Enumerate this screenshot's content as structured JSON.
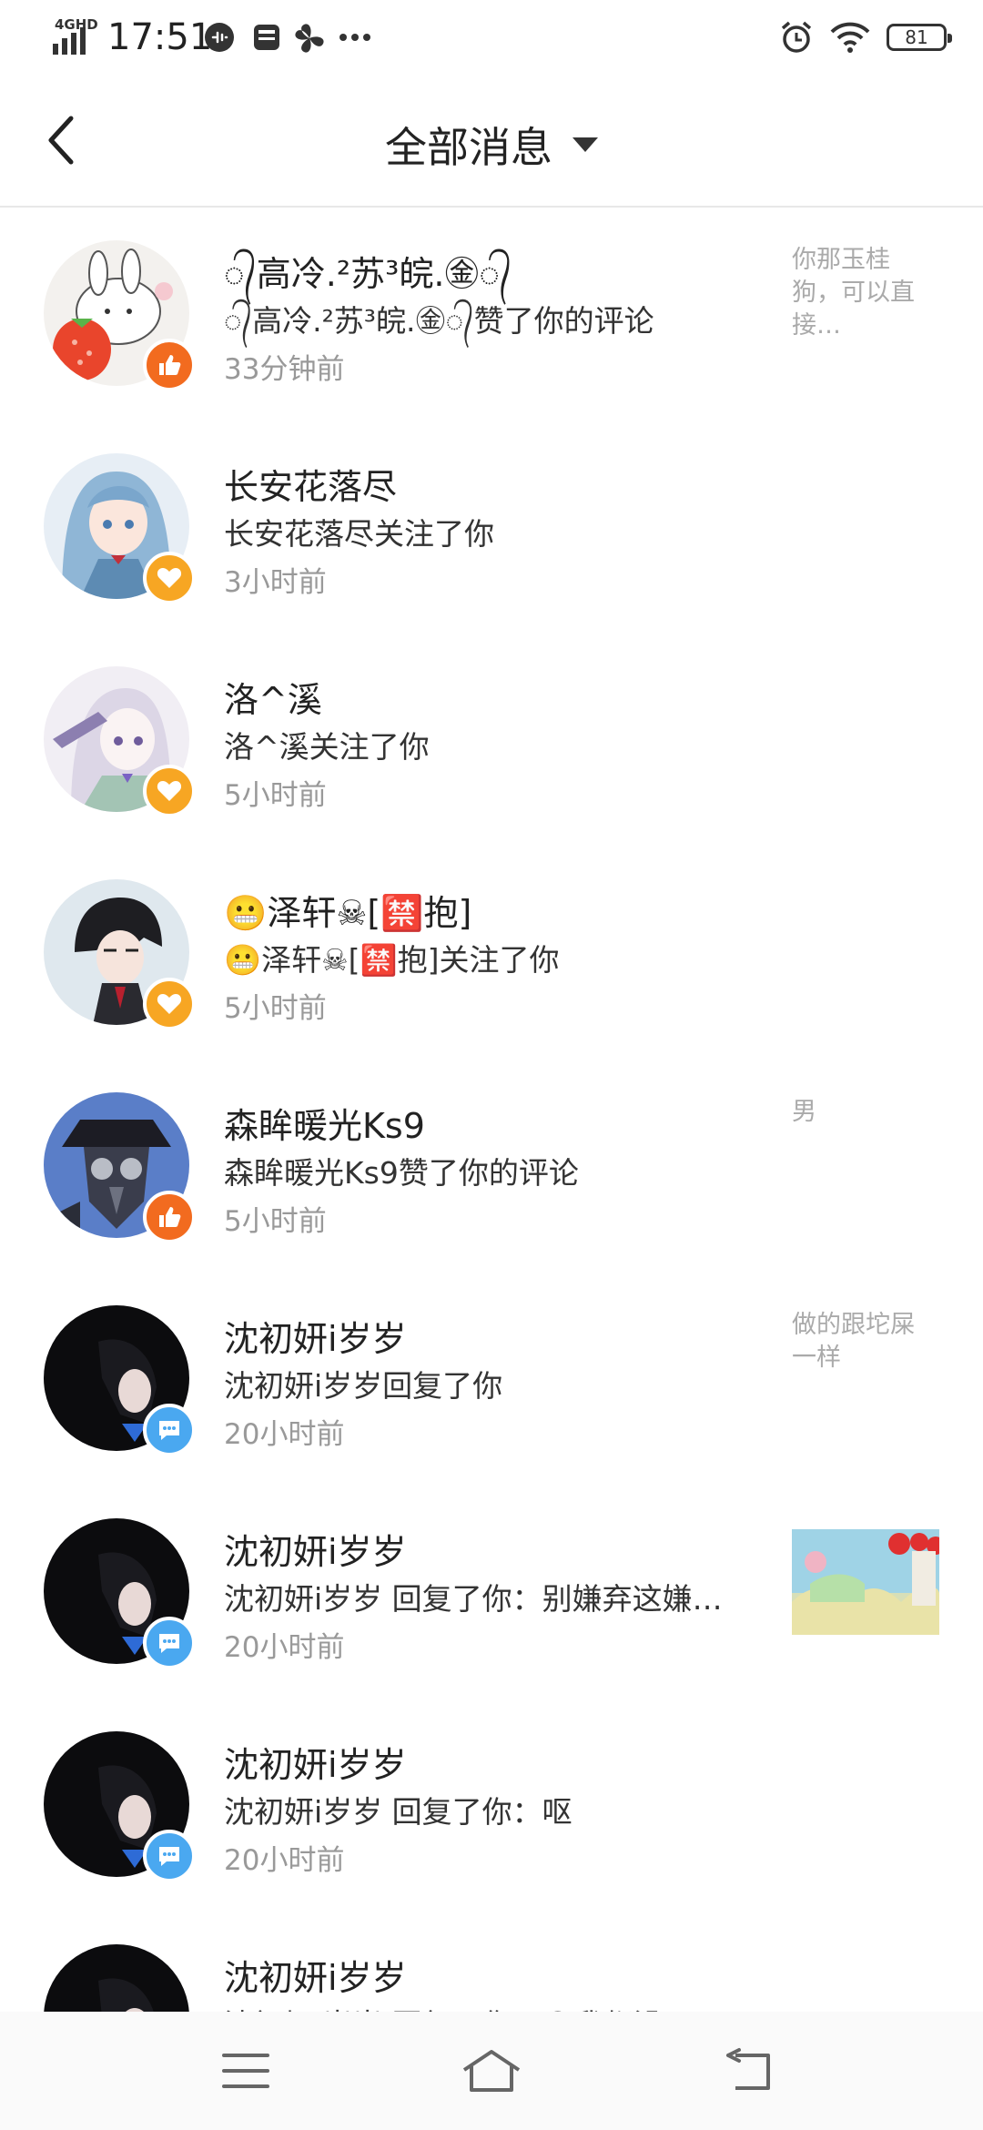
{
  "status_bar": {
    "network": "4GHD",
    "time": "17:51",
    "battery": "81",
    "icons": [
      "signal-icon",
      "message-badge-icon",
      "sim-card-icon",
      "fan-icon",
      "more-dots-icon",
      "alarm-icon",
      "wifi-icon",
      "battery-icon"
    ]
  },
  "header": {
    "title": "全部消息",
    "back_icon": "chevron-left-icon",
    "dropdown_icon": "caret-down-icon"
  },
  "messages": [
    {
      "name": "᭄高冷.²苏³皖.㊎᭄",
      "desc": "᭄高冷.²苏³皖.㊎᭄赞了你的评论",
      "time": "33分钟前",
      "type": "like",
      "ref": "你那玉桂狗，可以直接…"
    },
    {
      "name": "长安花落尽",
      "desc": "长安花落尽关注了你",
      "time": "3小时前",
      "type": "follow",
      "ref": ""
    },
    {
      "name": "洛^溪",
      "desc": "洛^溪关注了你",
      "time": "5小时前",
      "type": "follow",
      "ref": ""
    },
    {
      "name": "😬泽轩☠[🈲抱]",
      "desc": "😬泽轩☠[🈲抱]关注了你",
      "time": "5小时前",
      "type": "follow",
      "ref": ""
    },
    {
      "name": "森眸暖光Ks9",
      "desc": "森眸暖光Ks9赞了你的评论",
      "time": "5小时前",
      "type": "like",
      "ref": "男"
    },
    {
      "name": "沈初妍i岁岁",
      "desc": "沈初妍i岁岁回复了你",
      "time": "20小时前",
      "type": "reply",
      "ref": "做的跟坨屎一样"
    },
    {
      "name": "沈初妍i岁岁",
      "desc": "沈初妍i岁岁 回复了你：别嫌弃这嫌…",
      "time": "20小时前",
      "type": "reply",
      "ref": ""
    },
    {
      "name": "沈初妍i岁岁",
      "desc": "沈初妍i岁岁 回复了你：呕",
      "time": "20小时前",
      "type": "reply",
      "ref": ""
    },
    {
      "name": "沈初妍i岁岁",
      "desc": "沈初妍i岁岁 回复了你：😧我都没…",
      "time": "",
      "type": "reply",
      "ref": ""
    }
  ],
  "colors": {
    "like": "#f26b1f",
    "follow": "#f7a623",
    "reply": "#4aa8f0"
  },
  "nav_bar": {
    "icons": [
      "menu-icon",
      "home-icon",
      "back-icon"
    ]
  }
}
